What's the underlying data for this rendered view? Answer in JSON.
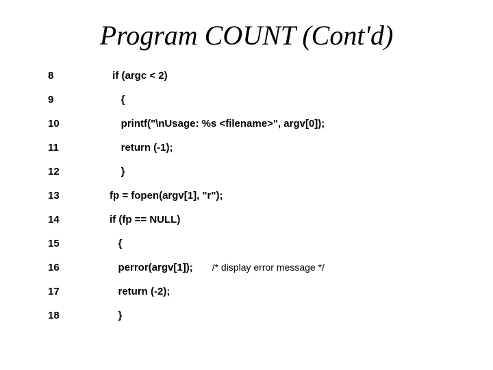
{
  "title": "Program COUNT (Cont'd)",
  "lines": [
    {
      "no": "8",
      "code": " if (argc < 2)"
    },
    {
      "no": "9",
      "code": "    {"
    },
    {
      "no": "10",
      "code": "    printf(\"\\nUsage: %s <filename>\", argv[0]);"
    },
    {
      "no": "11",
      "code": "    return (-1);"
    },
    {
      "no": "12",
      "code": "    }"
    },
    {
      "no": "13",
      "code": "fp = fopen(argv[1], \"r\");"
    },
    {
      "no": "14",
      "code": "if (fp == NULL)"
    },
    {
      "no": "15",
      "code": "   {"
    },
    {
      "no": "16",
      "code": "   perror(argv[1]);",
      "comment": "/* display error message */"
    },
    {
      "no": "17",
      "code": "   return (-2);"
    },
    {
      "no": "18",
      "code": "   }"
    }
  ]
}
